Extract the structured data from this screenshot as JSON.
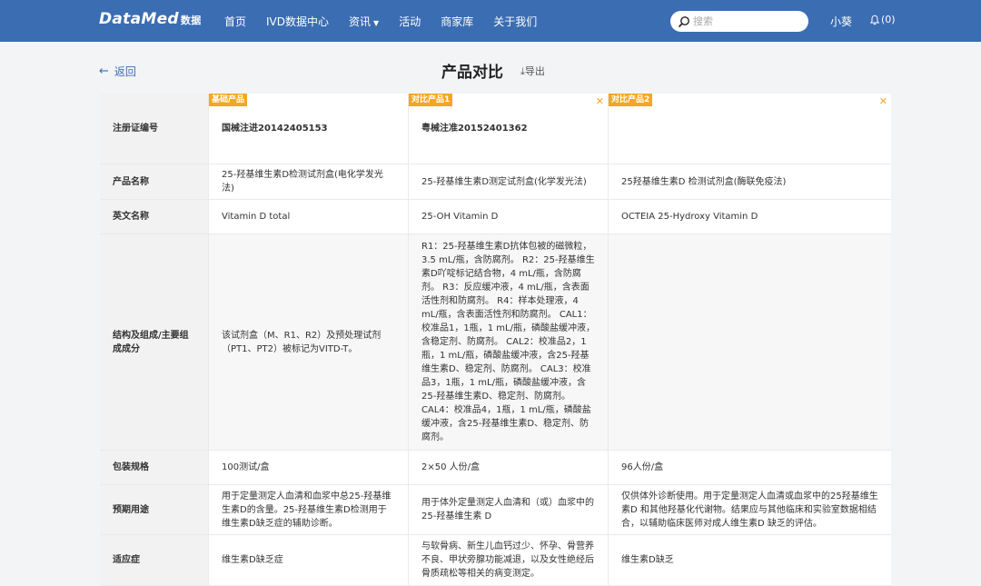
{
  "nav": {
    "logo": "DataMed",
    "logo_cn": "数据",
    "menu": [
      {
        "label": "首页",
        "caret": false
      },
      {
        "label": "IVD数据中心",
        "caret": false
      },
      {
        "label": "资讯",
        "caret": true
      },
      {
        "label": "活动",
        "caret": false
      },
      {
        "label": "商家库",
        "caret": false
      },
      {
        "label": "关于我们",
        "caret": false
      }
    ],
    "search_placeholder": "搜索",
    "user": "小葵",
    "notifications": "(0)"
  },
  "header": {
    "back": "返回",
    "title": "产品对比",
    "export": "导出"
  },
  "columns": [
    {
      "tag": "基础产品",
      "closable": false
    },
    {
      "tag": "对比产品1",
      "closable": true
    },
    {
      "tag": "对比产品2",
      "closable": true
    }
  ],
  "rows": [
    {
      "label": "注册证编号",
      "values": [
        "国械注进20142405153",
        "粤械注准20152401362",
        ""
      ]
    },
    {
      "label": "产品名称",
      "values": [
        "25-羟基维生素D检测试剂盒(电化学发光法)",
        "25-羟基维生素D测定试剂盒(化学发光法)",
        "25羟基维生素D 检测试剂盒(酶联免疫法)"
      ]
    },
    {
      "label": "英文名称",
      "values": [
        "Vitamin D total",
        "25-OH Vitamin D",
        "OCTEIA 25-Hydroxy Vitamin D"
      ]
    },
    {
      "label": "结构及组成/主要组成成分",
      "values": [
        "该试剂盒（M、R1、R2）及预处理试剂（PT1、PT2）被标记为VITD-T。",
        "R1：25-羟基维生素D抗体包被的磁微粒，3.5 mL/瓶，含防腐剂。 R2：25-羟基维生素D吖啶标记结合物，4 mL/瓶，含防腐剂。 R3：反应缓冲液，4 mL/瓶，含表面活性剂和防腐剂。 R4：样本处理液，4 mL/瓶，含表面活性剂和防腐剂。 CAL1：校准品1，1瓶，1 mL/瓶，磷酸盐缓冲液，含稳定剂、防腐剂。 CAL2：校准品2，1瓶，1 mL/瓶，磷酸盐缓冲液，含25-羟基维生素D、稳定剂、防腐剂。 CAL3：校准品3，1瓶，1 mL/瓶，磷酸盐缓冲液，含25-羟基维生素D、稳定剂、防腐剂。 CAL4：校准品4，1瓶，1 mL/瓶，磷酸盐缓冲液，含25-羟基维生素D、稳定剂、防腐剂。",
        ""
      ]
    },
    {
      "label": "包装规格",
      "values": [
        "100测试/盒",
        "2×50 人份/盒",
        "96人份/盒"
      ]
    },
    {
      "label": "预期用途",
      "values": [
        "用于定量测定人血清和血浆中总25-羟基维生素D的含量。25-羟基维生素D检测用于维生素D缺乏症的辅助诊断。",
        "用于体外定量测定人血清和（或）血浆中的 25-羟基维生素 D",
        "仅供体外诊断使用。用于定量测定人血清或血浆中的25羟基维生素D 和其他羟基化代谢物。结果应与其他临床和实验室数据相结合，以辅助临床医师对成人维生素D 缺乏的评估。"
      ]
    },
    {
      "label": "适应症",
      "values": [
        "维生素D缺乏症",
        "与软骨病、新生儿血钙过少、怀孕、骨营养不良、甲状旁腺功能减退，以及女性绝经后骨质疏松等相关的病变测定。",
        "维生素D缺乏"
      ]
    }
  ]
}
